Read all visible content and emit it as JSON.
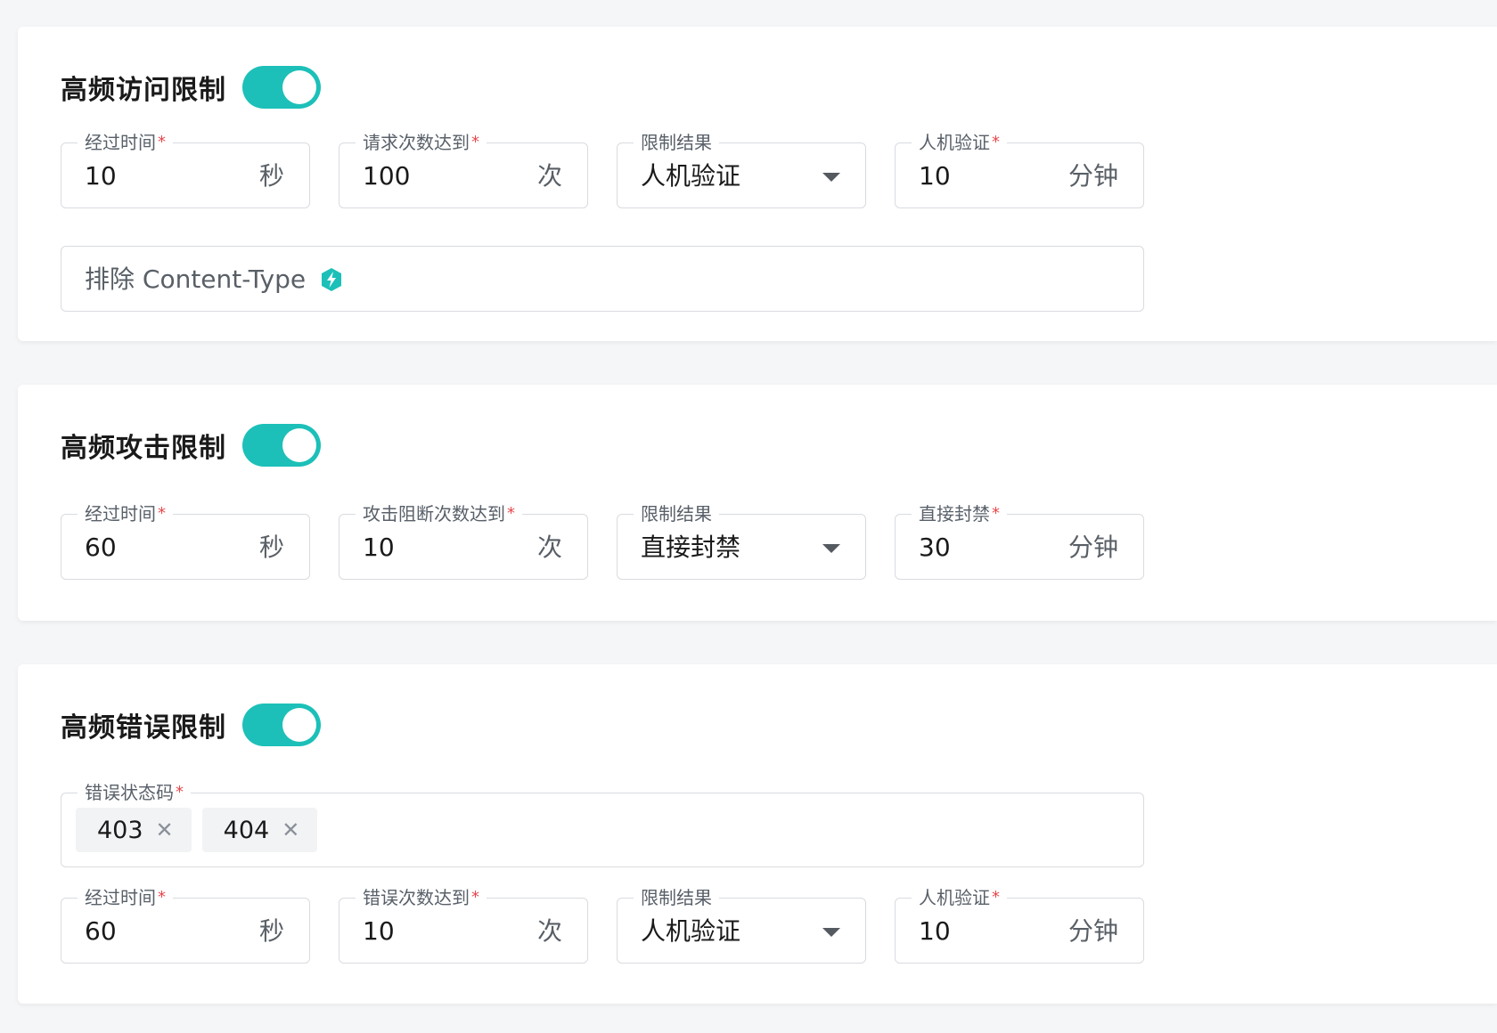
{
  "colors": {
    "accent": "#1cc0b8",
    "required": "#e5484d"
  },
  "sections": [
    {
      "title": "高频访问限制",
      "enabled": true,
      "fields": [
        {
          "label": "经过时间",
          "required": true,
          "value": "10",
          "unit": "秒"
        },
        {
          "label": "请求次数达到",
          "required": true,
          "value": "100",
          "unit": "次"
        },
        {
          "label": "限制结果",
          "required": false,
          "selected": "人机验证"
        },
        {
          "label": "人机验证",
          "required": true,
          "value": "10",
          "unit": "分钟"
        }
      ],
      "exclude_placeholder": "排除 Content-Type",
      "exclude_icon": "zap-badge-icon"
    },
    {
      "title": "高频攻击限制",
      "enabled": true,
      "fields": [
        {
          "label": "经过时间",
          "required": true,
          "value": "60",
          "unit": "秒"
        },
        {
          "label": "攻击阻断次数达到",
          "required": true,
          "value": "10",
          "unit": "次"
        },
        {
          "label": "限制结果",
          "required": false,
          "selected": "直接封禁"
        },
        {
          "label": "直接封禁",
          "required": true,
          "value": "30",
          "unit": "分钟"
        }
      ]
    },
    {
      "title": "高频错误限制",
      "enabled": true,
      "status_codes": {
        "label": "错误状态码",
        "required": true,
        "tags": [
          "403",
          "404"
        ],
        "remove_icon": "close-icon",
        "remove_glyph": "✕"
      },
      "fields": [
        {
          "label": "经过时间",
          "required": true,
          "value": "60",
          "unit": "秒"
        },
        {
          "label": "错误次数达到",
          "required": true,
          "value": "10",
          "unit": "次"
        },
        {
          "label": "限制结果",
          "required": false,
          "selected": "人机验证"
        },
        {
          "label": "人机验证",
          "required": true,
          "value": "10",
          "unit": "分钟"
        }
      ]
    }
  ],
  "required_mark": "*"
}
